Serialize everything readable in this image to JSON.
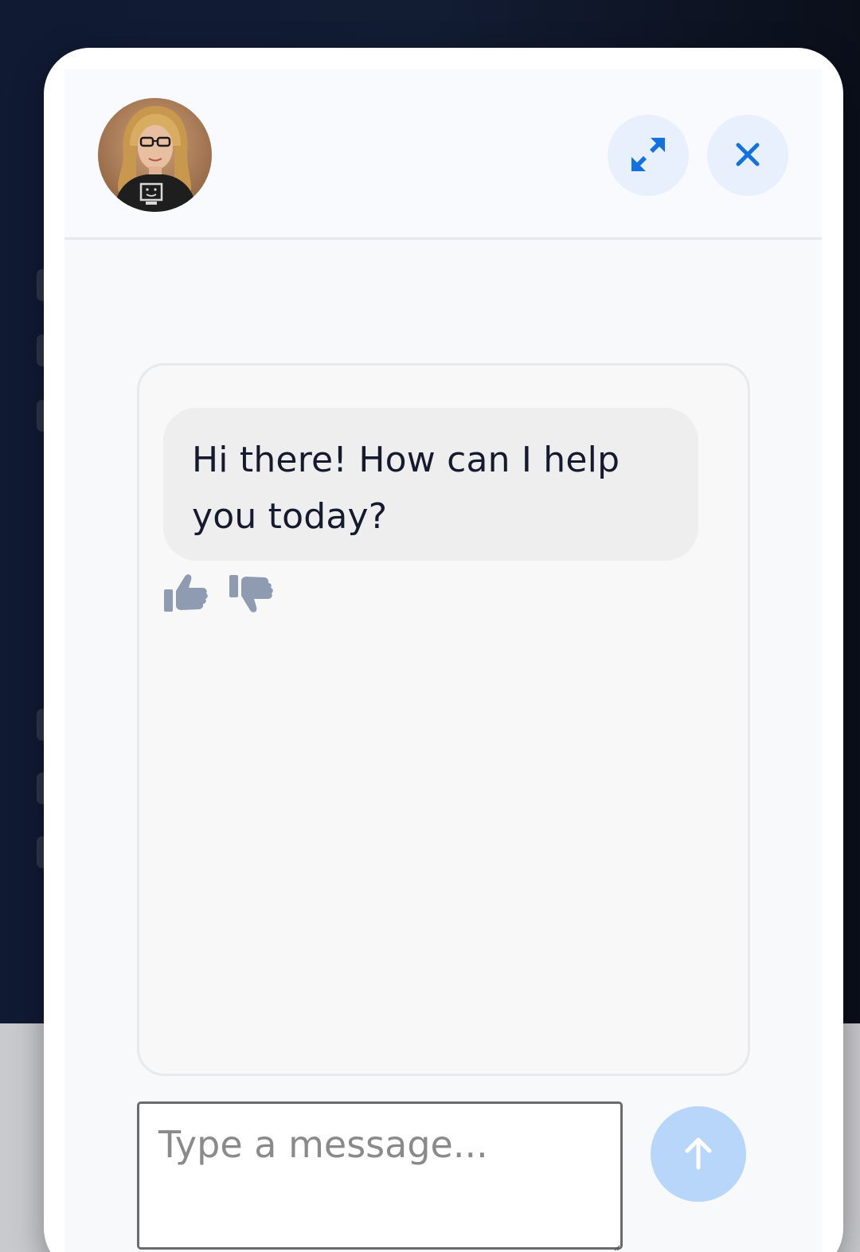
{
  "header": {
    "avatar_alt": "Assistant avatar",
    "expand_icon": "expand-arrows-icon",
    "close_icon": "close-x-icon"
  },
  "messages": [
    {
      "sender": "assistant",
      "text": "Hi there! How can I help you today?"
    }
  ],
  "feedback": {
    "up_icon": "thumbs-up-icon",
    "down_icon": "thumbs-down-icon"
  },
  "composer": {
    "placeholder": "Type a message...",
    "value": ""
  },
  "send": {
    "icon": "arrow-up-icon"
  },
  "colors": {
    "accent": "#1472e0",
    "header_button_bg": "#e8f0fd",
    "send_button_bg": "#b7d6fa",
    "feedback_icon": "#8f9bb0",
    "bubble_bg": "#eeeeee"
  }
}
